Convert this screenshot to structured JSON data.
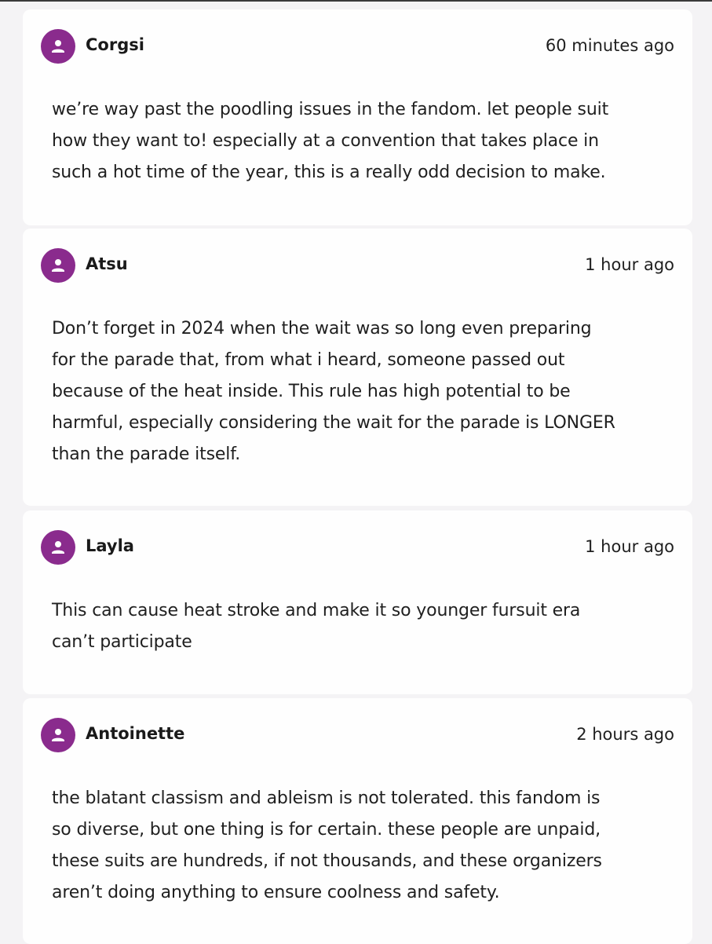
{
  "comments": [
    {
      "author": "Corgsi",
      "time": "60 minutes ago",
      "avatar_icon": "user-icon",
      "lines": [
        "we’re way past the poodling issues in the fandom. let people suit",
        "how they want to! especially at a convention that takes place in",
        "such a hot time of the year, this is a really odd decision to make."
      ]
    },
    {
      "author": "Atsu",
      "time": "1 hour ago",
      "avatar_icon": "user-icon",
      "lines": [
        "Don’t forget in 2024 when the wait was so long even preparing",
        "for the parade that, from what i heard, someone passed out",
        "because of the heat inside. This rule has high potential to be",
        "harmful, especially considering the wait for the parade is LONGER",
        "than the parade itself."
      ]
    },
    {
      "author": "Layla",
      "time": "1 hour ago",
      "avatar_icon": "user-icon",
      "lines": [
        "This can cause heat stroke and make it so younger fursuit era",
        "can’t participate"
      ]
    },
    {
      "author": "Antoinette",
      "time": "2 hours ago",
      "avatar_icon": "user-icon",
      "lines": [
        "the blatant classism and ableism is not tolerated. this fandom is",
        "so diverse, but one thing is for certain. these people are unpaid,",
        "these suits are hundreds, if not thousands, and these organizers",
        "aren’t doing anything to ensure coolness and safety."
      ]
    }
  ],
  "colors": {
    "avatar": "#8a2b8d",
    "page_background": "#f4f3f5",
    "card_background": "#fefefe"
  }
}
